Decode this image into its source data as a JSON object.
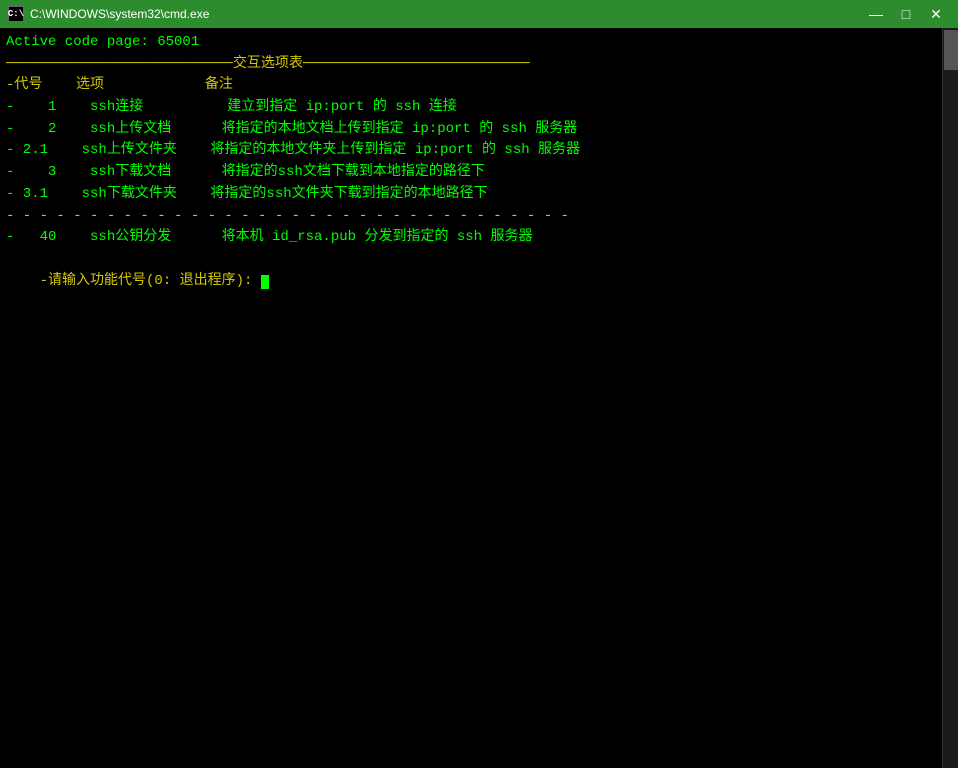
{
  "titlebar": {
    "icon_label": "C:\\",
    "title": "C:\\WINDOWS\\system32\\cmd.exe",
    "minimize_label": "—",
    "maximize_label": "□",
    "close_label": "✕"
  },
  "terminal": {
    "active_code_line": "Active code page: 65001",
    "separator_line": "───────────────────────────交互选项表───────────────────────────",
    "header_row": "-代号    选项            备注",
    "rows": [
      "-    1    ssh连接          建立到指定 ip:port 的 ssh 连接",
      "-    2    ssh上传文档      将指定的本地文档上传到指定 ip:port 的 ssh 服务器",
      "- 2.1    ssh上传文件夹    将指定的本地文件夹上传到指定 ip:port 的 ssh 服务器",
      "-    3    ssh下载文档      将指定的ssh文档下载到本地指定的路径下",
      "- 3.1    ssh下载文件夹    将指定的ssh文件夹下载到指定的本地路径下"
    ],
    "dashed_separator": "- - - - - - - - - - - - - - - - - - - - - - - - - - - - - - - - - -",
    "extra_row": "-   40    ssh公钥分发      将本机 id_rsa.pub 分发到指定的 ssh 服务器",
    "prompt": "-请输入功能代号(0: 退出程序): "
  }
}
